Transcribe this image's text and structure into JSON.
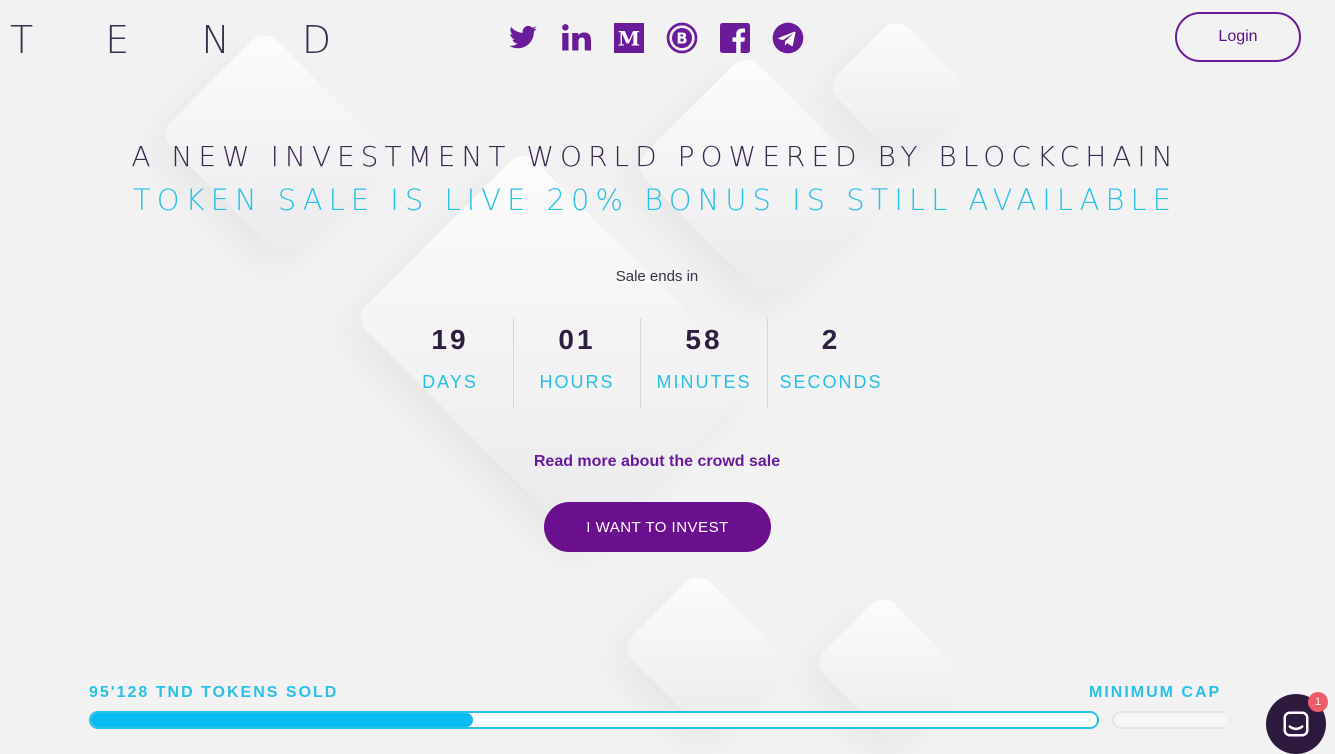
{
  "header": {
    "logo": "T E N D",
    "login_label": "Login",
    "social": [
      "twitter-icon",
      "linkedin-icon",
      "medium-icon",
      "bitcoin-icon",
      "facebook-icon",
      "telegram-icon"
    ]
  },
  "hero": {
    "headline": "A NEW INVESTMENT WORLD POWERED BY BLOCKCHAIN",
    "subheadline": "TOKEN SALE IS LIVE 20% BONUS IS STILL AVAILABLE"
  },
  "countdown": {
    "caption": "Sale ends in",
    "units": [
      {
        "value": "19",
        "label": "DAYS"
      },
      {
        "value": "01",
        "label": "HOURS"
      },
      {
        "value": "58",
        "label": "MINUTES"
      },
      {
        "value": "2",
        "label": "SECONDS"
      }
    ]
  },
  "cta": {
    "read_more": "Read more about the crowd sale",
    "invest_label": "I WANT TO INVEST"
  },
  "progress": {
    "sold_label": "95'128 TND TOKENS SOLD",
    "min_cap_label": "MINIMUM CAP",
    "fill_fraction": 0.38
  },
  "chat": {
    "badge": "1"
  },
  "colors": {
    "accent_purple": "#6a1b9a",
    "accent_cyan": "#29c0e8"
  }
}
